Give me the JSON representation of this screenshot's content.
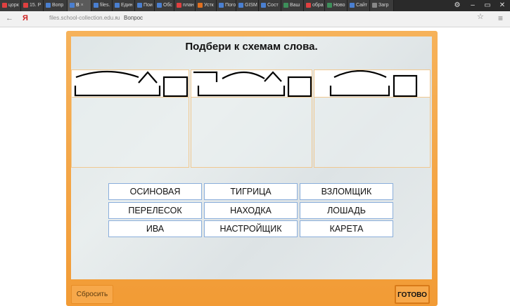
{
  "browser": {
    "tabs": [
      {
        "label": "цорк",
        "color": "#e04040"
      },
      {
        "label": "15. Р",
        "color": "#e04040"
      },
      {
        "label": "Вопр",
        "color": "#4a7fd0"
      },
      {
        "label": "В",
        "color": "#4a7fd0",
        "active": true
      },
      {
        "label": "files.",
        "color": "#4a7fd0"
      },
      {
        "label": "Един",
        "color": "#4a7fd0"
      },
      {
        "label": "Пои",
        "color": "#4a7fd0"
      },
      {
        "label": "Обс",
        "color": "#4a7fd0"
      },
      {
        "label": "план",
        "color": "#e04040"
      },
      {
        "label": "Устк",
        "color": "#e07020"
      },
      {
        "label": "Пого",
        "color": "#4a7fd0"
      },
      {
        "label": "GISM",
        "color": "#4a7fd0"
      },
      {
        "label": "Сост",
        "color": "#4a7fd0"
      },
      {
        "label": "Ваш",
        "color": "#3d8f5a"
      },
      {
        "label": "обра",
        "color": "#e04040"
      },
      {
        "label": "Ново",
        "color": "#3d8f5a"
      },
      {
        "label": "Сайт",
        "color": "#4a7fd0"
      },
      {
        "label": "Загр",
        "color": "#888888"
      }
    ],
    "tab_close": "×",
    "url_host": "files.school-collection.edu.ru",
    "url_separator": "›",
    "url_page": "Вопрос"
  },
  "task": {
    "title": "Подбери к схемам слова.",
    "words": [
      [
        "ОСИНОВАЯ",
        "ТИГРИЦА",
        "ВЗЛОМЩИК"
      ],
      [
        "ПЕРЕЛЕСОК",
        "НАХОДКА",
        "ЛОШАДЬ"
      ],
      [
        "ИВА",
        "НАСТРОЙЩИК",
        "КАРЕТА"
      ]
    ],
    "reset_label": "Сбросить",
    "done_label": "ГОТОВО"
  },
  "colors": {
    "frame": "#f29b35",
    "word_border": "#8aaedb",
    "panel_border": "#f0c890"
  }
}
